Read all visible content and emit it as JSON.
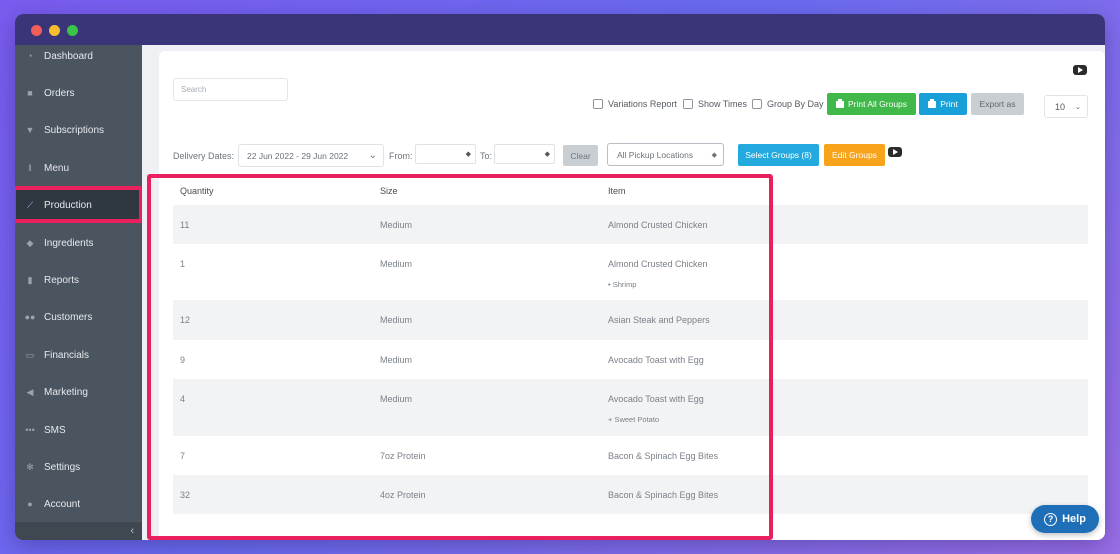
{
  "sidebar": {
    "items": [
      {
        "label": "Dashboard",
        "icon": "dashboard-icon"
      },
      {
        "label": "Orders",
        "icon": "orders-icon"
      },
      {
        "label": "Subscriptions",
        "icon": "cart-icon"
      },
      {
        "label": "Menu",
        "icon": "utensils-icon"
      },
      {
        "label": "Production",
        "icon": "chart-line-icon"
      },
      {
        "label": "Ingredients",
        "icon": "ingredients-icon"
      },
      {
        "label": "Reports",
        "icon": "file-icon"
      },
      {
        "label": "Customers",
        "icon": "users-icon"
      },
      {
        "label": "Financials",
        "icon": "money-icon"
      },
      {
        "label": "Marketing",
        "icon": "megaphone-icon"
      },
      {
        "label": "SMS",
        "icon": "comment-icon"
      },
      {
        "label": "Settings",
        "icon": "gear-icon"
      },
      {
        "label": "Account",
        "icon": "user-icon"
      }
    ],
    "active": "Production",
    "collapse_glyph": "‹"
  },
  "toolbar": {
    "search_placeholder": "Search",
    "variations_report": "Variations Report",
    "show_times": "Show Times",
    "group_by_day": "Group By Day",
    "print_all_groups": "Print All Groups",
    "print": "Print",
    "export_as": "Export as",
    "per_page": "10"
  },
  "filters": {
    "delivery_dates_label": "Delivery Dates:",
    "date_range": "22 Jun 2022 - 29 Jun 2022",
    "from_label": "From:",
    "to_label": "To:",
    "clear": "Clear",
    "pickup_locations": "All Pickup Locations",
    "select_groups": "Select Groups (8)",
    "edit_groups": "Edit Groups"
  },
  "table": {
    "headers": {
      "quantity": "Quantity",
      "size": "Size",
      "item": "Item"
    },
    "rows": [
      {
        "quantity": "11",
        "size": "Medium",
        "item": "Almond Crusted Chicken",
        "note": ""
      },
      {
        "quantity": "1",
        "size": "Medium",
        "item": "Almond Crusted Chicken",
        "note": "• Shrimp"
      },
      {
        "quantity": "12",
        "size": "Medium",
        "item": "Asian Steak and Peppers",
        "note": ""
      },
      {
        "quantity": "9",
        "size": "Medium",
        "item": "Avocado Toast with Egg",
        "note": ""
      },
      {
        "quantity": "4",
        "size": "Medium",
        "item": "Avocado Toast with Egg",
        "note": "+ Sweet Potato"
      },
      {
        "quantity": "7",
        "size": "7oz Protein",
        "item": "Bacon & Spinach Egg Bites",
        "note": ""
      },
      {
        "quantity": "32",
        "size": "4oz Protein",
        "item": "Bacon & Spinach Egg Bites",
        "note": ""
      }
    ]
  },
  "help": {
    "label": "Help"
  },
  "colors": {
    "titlebar": "#3a3479",
    "sidebar": "#4b5560",
    "highlight": "#ea1f5e",
    "green_button": "#40b84a",
    "blue_button": "#1aa0d8",
    "orange_button": "#f7a41a"
  }
}
